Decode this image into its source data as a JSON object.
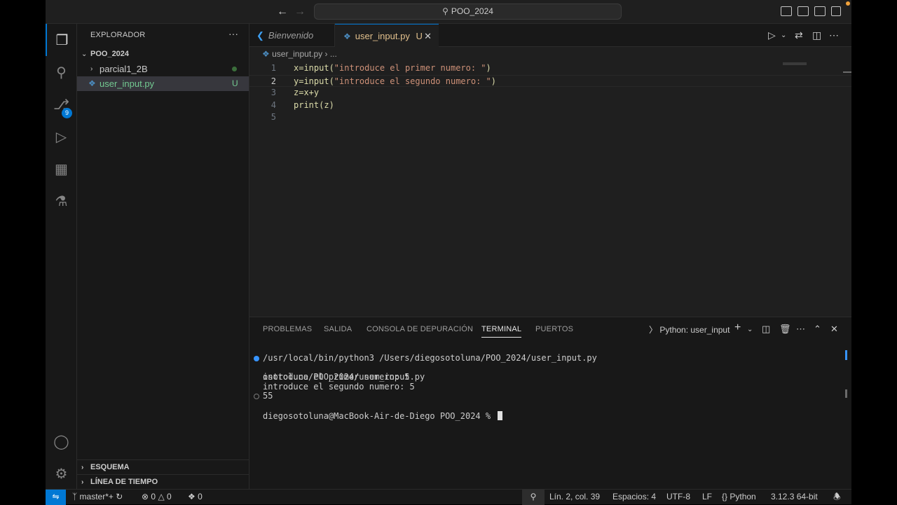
{
  "titlebar": {
    "back_icon": "arrow-left-icon",
    "forward_icon": "arrow-right-icon",
    "search_text": "POO_2024"
  },
  "activity": {
    "items": [
      "explorer-icon",
      "search-icon",
      "source-control-icon",
      "run-debug-icon",
      "extensions-icon",
      "testing-icon"
    ],
    "scm_badge": "9",
    "accounts_icon": "account-icon",
    "manage_icon": "gear-icon"
  },
  "sidebar": {
    "title": "EXPLORADOR",
    "more": "···",
    "root": "POO_2024",
    "items": [
      {
        "label": "parcial1_2B",
        "type": "folder"
      },
      {
        "label": "user_input.py",
        "type": "file",
        "status": "U"
      }
    ],
    "outline": "ESQUEMA",
    "timeline": "LÍNEA DE TIEMPO"
  },
  "editor": {
    "tabs": [
      {
        "label": "Bienvenido",
        "active": false
      },
      {
        "label": "user_input.py",
        "status": "U",
        "active": true
      }
    ],
    "breadcrumb": {
      "file": "user_input.py",
      "rest": "..."
    },
    "lines": [
      {
        "num": "1",
        "prefix": "x=input(",
        "str": "\"introduce el primer numero: \"",
        "suffix": ")"
      },
      {
        "num": "2",
        "prefix": "y=input(",
        "str": "\"introduce el segundo numero: \"",
        "suffix": ")"
      },
      {
        "num": "3",
        "prefix": "z=x+y",
        "str": "",
        "suffix": ""
      },
      {
        "num": "4",
        "prefix": "print(z)",
        "str": "",
        "suffix": ""
      },
      {
        "num": "5",
        "prefix": "",
        "str": "",
        "suffix": ""
      }
    ]
  },
  "panel": {
    "tabs": [
      "PROBLEMAS",
      "SALIDA",
      "CONSOLA DE DEPURACIÓN",
      "TERMINAL",
      "PUERTOS"
    ],
    "active_tab": "TERMINAL",
    "terminal_name": "Python: user_input",
    "terminal_lines": [
      "/usr/local/bin/python3 /Users/diegosotoluna/POO_2024/user_input.py",
      "osotoluna/POO_2024/user_input.py",
      "introduce el primer numero: 5",
      "introduce el segundo numero: 5",
      "55",
      "diegosotoluna@MacBook-Air-de-Diego POO_2024 % "
    ]
  },
  "statusbar": {
    "branch": "master*+",
    "errors": "0",
    "warnings": "0",
    "ports": "0",
    "position": "Lín. 2, col. 39",
    "spaces": "Espacios: 4",
    "encoding": "UTF-8",
    "eol": "LF",
    "language": "Python",
    "interpreter": "3.12.3 64-bit"
  },
  "colors": {
    "accent": "#0078d4",
    "untracked": "#73c991",
    "modified_tab": "#e2c08d",
    "string": "#ce9178"
  }
}
